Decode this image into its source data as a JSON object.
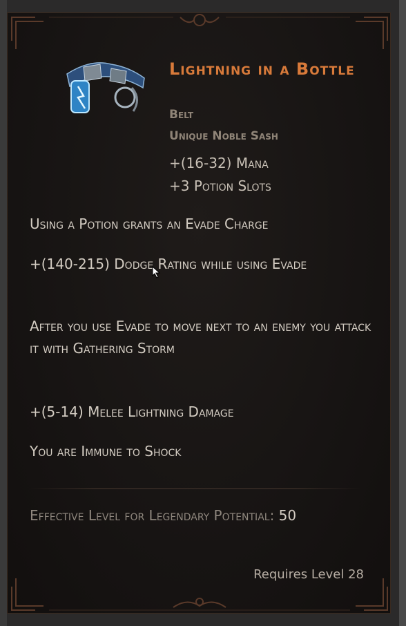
{
  "item": {
    "title": "Lightning in a Bottle",
    "type": "Belt",
    "subtype": "Unique Noble Sash",
    "implicits": [
      "+(16-32) Mana",
      "+3 Potion Slots"
    ],
    "mods": [
      "Using a Potion grants an Evade Charge",
      "+(140-215) Dodge Rating while using Evade",
      "After you use Evade to move next to an enemy you attack it with Gathering Storm",
      "+(5-14) Melee Lightning Damage",
      "You are Immune to Shock"
    ],
    "legendary_label": "Effective Level for Legendary Potential:",
    "legendary_value": "50",
    "requires": "Requires Level 28",
    "icon": "belt-icon"
  },
  "colors": {
    "title": "#d87a3a",
    "type": "#8f8477",
    "text": "#d3ccc2",
    "frame": "#5a3a2a"
  }
}
